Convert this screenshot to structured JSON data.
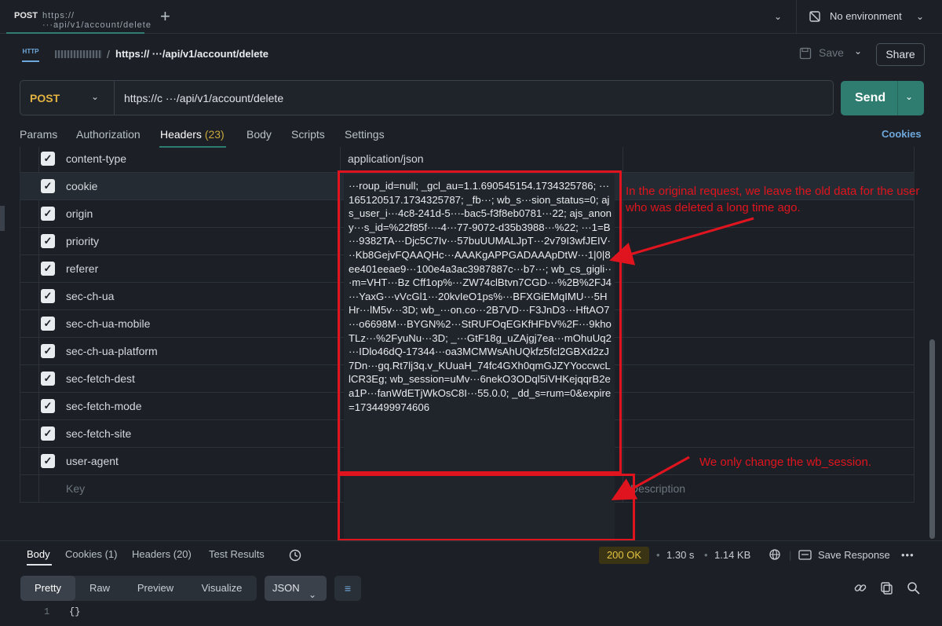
{
  "tab": {
    "method": "POST",
    "name": "https://···api/v1/account/delete"
  },
  "env": {
    "label": "No environment"
  },
  "breadcrumb": {
    "url": "https:// ···/api/v1/account/delete"
  },
  "toolbar": {
    "save_label": "Save",
    "share_label": "Share"
  },
  "request": {
    "method": "POST",
    "url": "https://c ···/api/v1/account/delete",
    "send_label": "Send"
  },
  "req_tabs": {
    "params": "Params",
    "authorization": "Authorization",
    "headers": "Headers",
    "headers_count": "(23)",
    "body": "Body",
    "scripts": "Scripts",
    "settings": "Settings",
    "cookies": "Cookies"
  },
  "headers": [
    {
      "key": "content-type",
      "value": "application/json"
    },
    {
      "key": "cookie",
      "value": ""
    },
    {
      "key": "origin",
      "value": ""
    },
    {
      "key": "priority",
      "value": ""
    },
    {
      "key": "referer",
      "value": ""
    },
    {
      "key": "sec-ch-ua",
      "value": ""
    },
    {
      "key": "sec-ch-ua-mobile",
      "value": ""
    },
    {
      "key": "sec-ch-ua-platform",
      "value": ""
    },
    {
      "key": "sec-fetch-dest",
      "value": ""
    },
    {
      "key": "sec-fetch-mode",
      "value": ""
    },
    {
      "key": "sec-fetch-site",
      "value": ""
    },
    {
      "key": "user-agent",
      "value": ""
    }
  ],
  "new_row": {
    "key_placeholder": "Key",
    "desc_placeholder": "Description"
  },
  "cookie_value": "···roup_id=null; _gcl_au=1.1.690545154.1734325786; ···165120517.1734325787; _fb···; wb_s···sion_status=0; ajs_user_i···4c8-241d-5···-bac5-f3f8eb0781···22; ajs_anony···s_id=%22f85f···-4···77-9072-d35b3988···%22; ···1=B···9382TA···Djc5C7Iv···57buUUMALJpT···2v79I3wfJEIV···Kb8GejvFQAAQHc···AAAKgAPPGADAAApDtW···1|0|8ee401eeae9···100e4a3ac3987887c···b7···; wb_cs_gigli···m=VHT···Bz Cff1op%···ZW74clBtvn7CGD···%2B%2FJ4···YaxG···vVcGl1···20kvIeO1ps%···BFXGiEMqIMU···5HHr···lM5v···3D; wb_···on.co···2B7VD···F3JnD3···HftAO7···o6698M···BYGN%2···StRUFOqEGKfHFbV%2F···9khoTLz···%2FyuNu···3D; _···GtF18g_uZAjgj7ea···mOhuUq2···IDlo46dQ-17344···oa3MCMWsAhUQkfz5fcl2GBXd2zJ7Dn···gq.Rt7lj3q.v_KUuaH_74fc4GXh0qmGJZYYoccwcLlCR3Eg; wb_session=uMv···6nekO3ODql5iVHKejqqrB2ea1P···fanWdETjWkOsC8I···55.0.0; _dd_s=rum=0&expire=1734499974606",
  "annotations": {
    "top": "In the original request, we leave the old data for the user who was deleted a long time ago.",
    "bottom": "We only change the wb_session."
  },
  "response": {
    "tabs": {
      "body": "Body",
      "cookies": "Cookies (1)",
      "headers": "Headers (20)",
      "test_results": "Test Results"
    },
    "status": "200 OK",
    "time": "1.30 s",
    "size": "1.14 KB",
    "save_response": "Save Response",
    "view_modes": [
      "Pretty",
      "Raw",
      "Preview",
      "Visualize"
    ],
    "format": "JSON",
    "line_number": "1",
    "code": "{}"
  },
  "colors": {
    "accent": "#2f7d70",
    "annotation_red": "#e0141e",
    "method_post": "#e3b341"
  }
}
